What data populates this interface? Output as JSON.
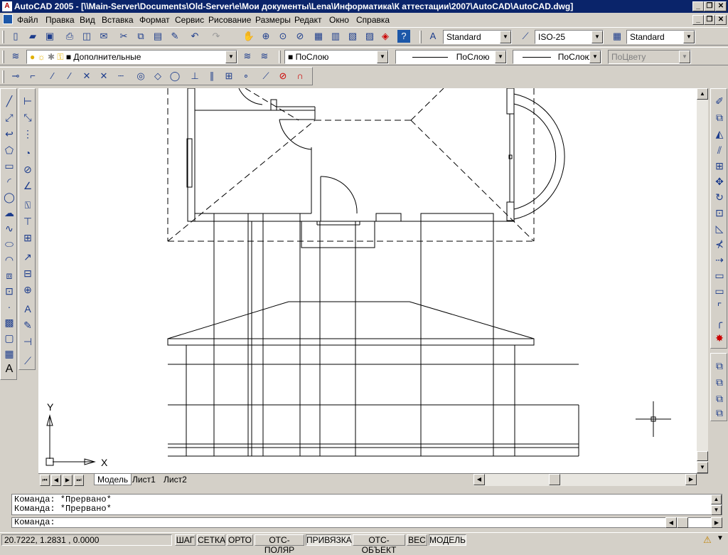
{
  "window": {
    "title": "AutoCAD 2005 - [\\\\Main-Server\\Documents\\Old-Server\\e\\Мои документы\\Lena\\Информатика\\К аттестации\\2007\\AutoCAD\\AutoCAD.dwg]",
    "app_icon": "autocad-icon",
    "minimize": "_",
    "restore": "❐",
    "close": "✕"
  },
  "menu": {
    "items": [
      "Файл",
      "Правка",
      "Вид",
      "Вставка",
      "Формат",
      "Сервис",
      "Рисование",
      "Размеры",
      "Редакт",
      "Окно",
      "Справка"
    ]
  },
  "standard_toolbar": {
    "text_style": "Standard",
    "dim_style": "ISO-25",
    "table_style": "Standard"
  },
  "layers_toolbar": {
    "current_layer": "Дополнительные"
  },
  "properties_toolbar": {
    "color": "ПоСлою",
    "linetype": "ПоСлою",
    "lineweight": "ПоСлою",
    "plot_style": "ПоЦвету"
  },
  "ucs": {
    "x_label": "X",
    "y_label": "Y"
  },
  "layout_tabs": [
    "Модель",
    "Лист1",
    "Лист2"
  ],
  "command_history": [
    "Команда: *Прервано*",
    "Команда: *Прервано*"
  ],
  "command_prompt": "Команда:",
  "status": {
    "coordinates": "20.7222, 1.2831 , 0.0000",
    "toggles": [
      {
        "label": "ШАГ",
        "on": false
      },
      {
        "label": "СЕТКА",
        "on": false
      },
      {
        "label": "ОРТО",
        "on": false
      },
      {
        "label": "ОТС-ПОЛЯР",
        "on": false
      },
      {
        "label": "ПРИВЯЗКА",
        "on": true
      },
      {
        "label": "ОТС-ОБЪЕКТ",
        "on": false
      },
      {
        "label": "ВЕС",
        "on": false
      },
      {
        "label": "МОДЕЛЬ",
        "on": true
      }
    ]
  },
  "colors": {
    "titlebar": "#0a246a",
    "chrome": "#d4d0c8",
    "canvas": "#ffffff",
    "line": "#000000"
  }
}
